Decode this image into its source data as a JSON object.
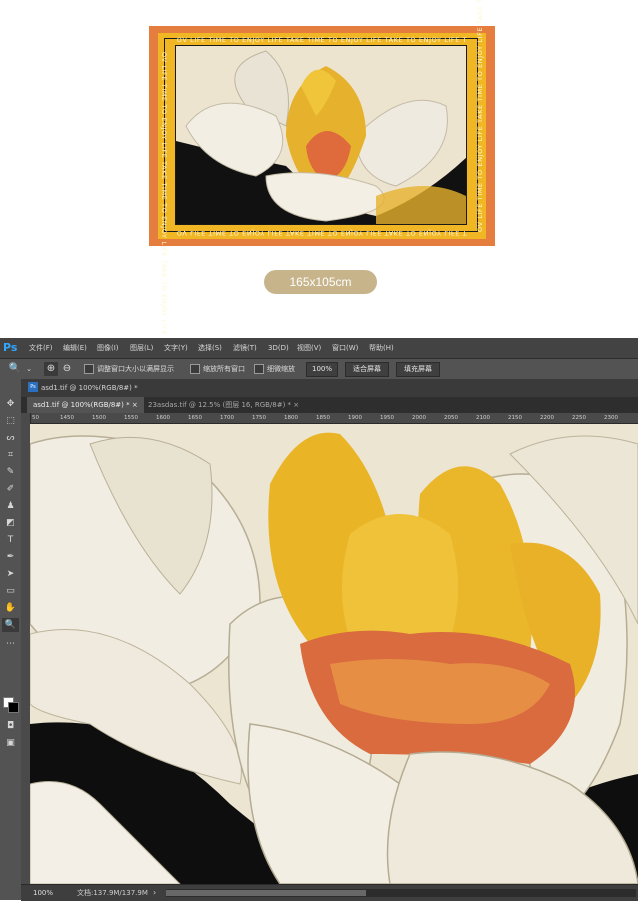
{
  "preview": {
    "border_text": "OV LIFE TIME TO ENJOY LIFE TAKE TIME TO ENJOY LIFE TAKE TO ENJOY LIFE T",
    "size_label": "165x105cm",
    "colors": {
      "outer_border": "#e57d3e",
      "inner_border": "#f0b623",
      "size_pill": "#c8b48b"
    }
  },
  "photoshop": {
    "logo": "Ps",
    "menu": [
      "文件(F)",
      "编辑(E)",
      "图像(I)",
      "图层(L)",
      "文字(Y)",
      "选择(S)",
      "滤镜(T)",
      "3D(D)",
      "视图(V)",
      "窗口(W)",
      "帮助(H)"
    ],
    "options": {
      "checkbox1": "调整窗口大小以满屏显示",
      "checkbox2": "缩放所有窗口",
      "checkbox3": "细微缩放",
      "zoom_value": "100%",
      "fit_screen": "适合屏幕",
      "fill_screen": "填充屏幕"
    },
    "panel_title": "asd1.tif @ 100%(RGB/8#) *",
    "tabs": [
      {
        "label": "asd1.tif @ 100%(RGB/8#) *",
        "close": "×"
      },
      {
        "label": "23asdas.tif @ 12.5% (图层 16, RGB/8#) *",
        "close": "×"
      }
    ],
    "ruler_ticks": [
      "50",
      "1450",
      "1500",
      "1550",
      "1600",
      "1650",
      "1700",
      "1750",
      "1800",
      "1850",
      "1900",
      "1950",
      "2000",
      "2050",
      "2100",
      "2150",
      "2200",
      "2250",
      "2300"
    ],
    "status": {
      "zoom": "100%",
      "doc": "文档:137.9M/137.9M",
      "arrow": "›"
    },
    "tools": [
      "move-tool",
      "marquee-tool",
      "lasso-tool",
      "crop-tool",
      "eyedropper-tool",
      "brush-tool",
      "stamp-tool",
      "eraser-tool",
      "type-tool",
      "pen-tool",
      "path-select-tool",
      "rectangle-tool",
      "hand-tool",
      "zoom-tool"
    ]
  }
}
